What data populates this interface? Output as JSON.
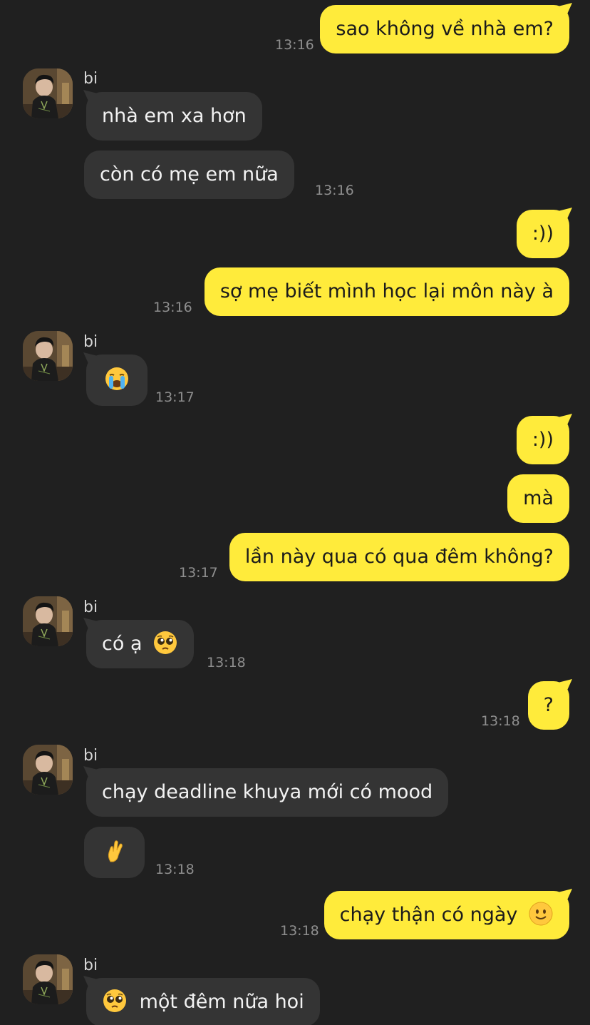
{
  "contact": {
    "name": "bi"
  },
  "colors": {
    "background": "#202020",
    "outgoing_bubble": "#FFEB3B",
    "incoming_bubble": "#343434"
  },
  "messages": [
    {
      "from": "me",
      "text": "sao không về nhà em?",
      "time": "13:16"
    },
    {
      "from": "them",
      "text": "nhà em xa hơn"
    },
    {
      "from": "them",
      "text": "còn có mẹ em nữa",
      "time": "13:16"
    },
    {
      "from": "me",
      "text": ":))"
    },
    {
      "from": "me",
      "text": "sợ mẹ biết mình học lại môn này à",
      "time": "13:16"
    },
    {
      "from": "them",
      "emoji": "loudly-crying-face-emoji",
      "time": "13:17"
    },
    {
      "from": "me",
      "text": ":))"
    },
    {
      "from": "me",
      "text": "mà"
    },
    {
      "from": "me",
      "text": "lần này qua có qua đêm không?",
      "time": "13:17"
    },
    {
      "from": "them",
      "text": "có ạ",
      "emoji": "pleading-face-emoji",
      "time": "13:18"
    },
    {
      "from": "me",
      "text": "?",
      "time": "13:18"
    },
    {
      "from": "them",
      "text": "chạy deadline khuya mới có mood"
    },
    {
      "from": "them",
      "emoji": "crossed-fingers-emoji",
      "time": "13:18"
    },
    {
      "from": "me",
      "text": "chạy thận có ngày",
      "emoji": "slightly-smiling-face-emoji",
      "time": "13:18"
    },
    {
      "from": "them",
      "text": "một đêm nữa hoi",
      "emoji": "pleading-face-emoji"
    }
  ]
}
